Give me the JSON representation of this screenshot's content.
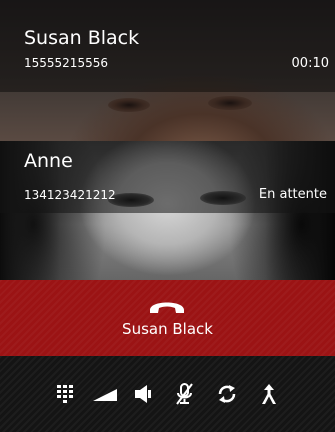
{
  "calls": {
    "active": {
      "name": "Susan Black",
      "number": "15555215556",
      "duration": "00:10"
    },
    "held": {
      "name": "Anne",
      "number": "134123421212",
      "status": "En attente"
    }
  },
  "hangup": {
    "label": "Susan Black",
    "color": "#9b1314"
  },
  "toolbar": {
    "items": [
      {
        "name": "keypad",
        "icon": "dialpad-icon"
      },
      {
        "name": "volume",
        "icon": "volume-ramp-icon"
      },
      {
        "name": "speaker",
        "icon": "speaker-icon"
      },
      {
        "name": "mute",
        "icon": "microphone-muted-icon"
      },
      {
        "name": "swap",
        "icon": "swap-calls-icon"
      },
      {
        "name": "merge",
        "icon": "merge-calls-icon"
      }
    ]
  }
}
